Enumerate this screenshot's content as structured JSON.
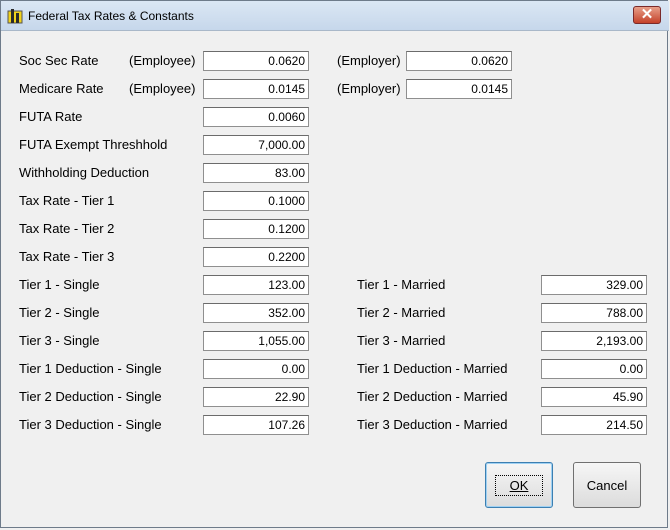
{
  "window": {
    "title": "Federal Tax Rates & Constants"
  },
  "rows": {
    "soc_sec": {
      "label": "Soc Sec Rate",
      "employee_label": "(Employee)",
      "employee": "0.0620",
      "employer_label": "(Employer)",
      "employer": "0.0620"
    },
    "medicare": {
      "label": "Medicare Rate",
      "employee_label": "(Employee)",
      "employee": "0.0145",
      "employer_label": "(Employer)",
      "employer": "0.0145"
    },
    "futa_rate": {
      "label": "FUTA Rate",
      "value": "0.0060"
    },
    "futa_exempt": {
      "label": "FUTA Exempt Threshhold",
      "value": "7,000.00"
    },
    "withholding": {
      "label": "Withholding Deduction",
      "value": "83.00"
    },
    "tax_tier1": {
      "label": "Tax Rate - Tier 1",
      "value": "0.1000"
    },
    "tax_tier2": {
      "label": "Tax Rate - Tier 2",
      "value": "0.1200"
    },
    "tax_tier3": {
      "label": "Tax Rate - Tier 3",
      "value": "0.2200"
    }
  },
  "tiers": {
    "t1": {
      "single_label": "Tier 1 - Single",
      "single": "123.00",
      "married_label": "Tier 1 - Married",
      "married": "329.00"
    },
    "t2": {
      "single_label": "Tier 2 - Single",
      "single": "352.00",
      "married_label": "Tier 2 - Married",
      "married": "788.00"
    },
    "t3": {
      "single_label": "Tier 3 - Single",
      "single": "1,055.00",
      "married_label": "Tier 3 - Married",
      "married": "2,193.00"
    },
    "d1": {
      "single_label": "Tier 1 Deduction - Single",
      "single": "0.00",
      "married_label": "Tier 1 Deduction - Married",
      "married": "0.00"
    },
    "d2": {
      "single_label": "Tier 2 Deduction - Single",
      "single": "22.90",
      "married_label": "Tier 2 Deduction - Married",
      "married": "45.90"
    },
    "d3": {
      "single_label": "Tier 3 Deduction - Single",
      "single": "107.26",
      "married_label": "Tier 3 Deduction - Married",
      "married": "214.50"
    }
  },
  "buttons": {
    "ok": "OK",
    "cancel": "Cancel"
  },
  "icons": {
    "app": "app-icon",
    "close": "close-icon"
  }
}
